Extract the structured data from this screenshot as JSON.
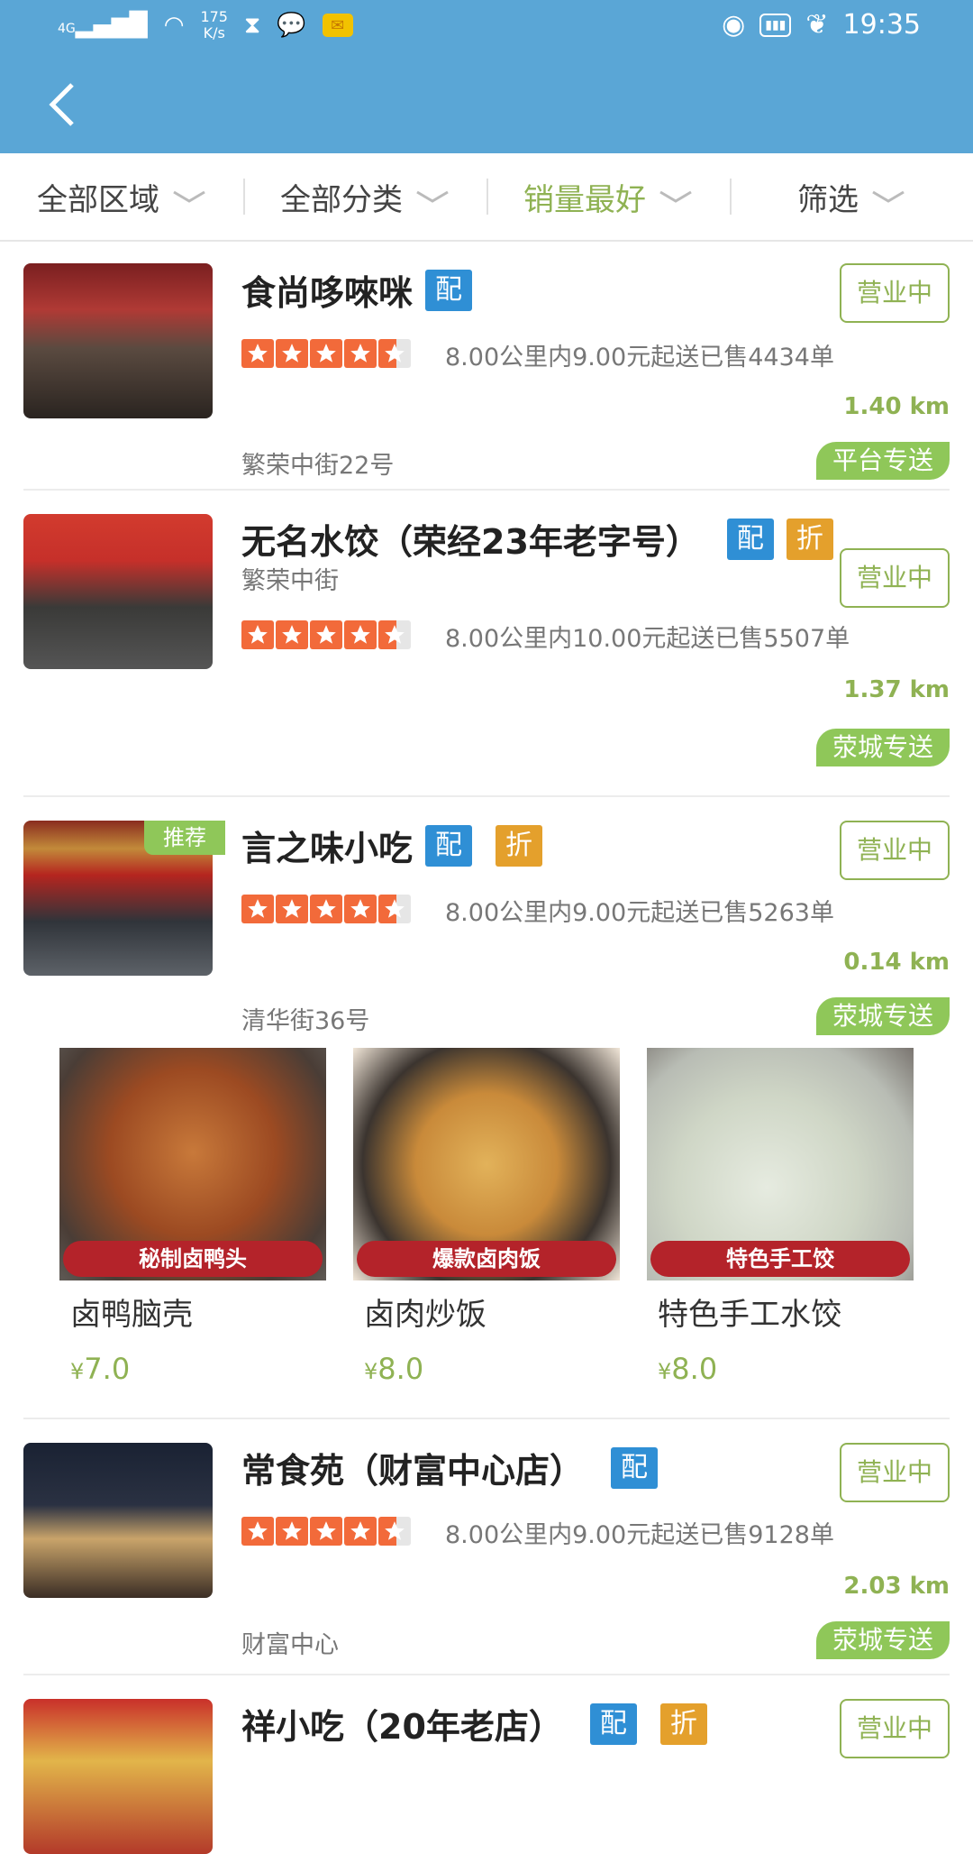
{
  "status": {
    "network": "4G",
    "speed_value": "175",
    "speed_unit": "K/s",
    "time": "19:35"
  },
  "filters": [
    {
      "label": "全部区域",
      "active": false
    },
    {
      "label": "全部分类",
      "active": false
    },
    {
      "label": "销量最好",
      "active": true
    },
    {
      "label": "筛选",
      "active": false
    }
  ],
  "shops": [
    {
      "name": "食尚哆唻咪",
      "tags": [
        "配"
      ],
      "status": "营业中",
      "rating": 4.5,
      "info": "8.00公里内9.00元起送已售4434单",
      "distance": "1.40 km",
      "address": "繁荣中街22号",
      "delivery": "平台专送",
      "recommended": false
    },
    {
      "name": "无名水饺（荣经23年老字号）",
      "tags": [
        "配",
        "折"
      ],
      "status": "营业中",
      "rating": 4.5,
      "info": "8.00公里内10.00元起送已售5507单",
      "distance": "1.37 km",
      "address": "繁荣中街",
      "delivery": "荥城专送",
      "recommended": false
    },
    {
      "name": "言之味小吃",
      "tags": [
        "配",
        "折"
      ],
      "status": "营业中",
      "rating": 4.5,
      "info": "8.00公里内9.00元起送已售5263单",
      "distance": "0.14 km",
      "address": "清华街36号",
      "delivery": "荥城专送",
      "recommended": true,
      "recommend_label": "推荐"
    },
    {
      "name": "常食苑（财富中心店）",
      "tags": [
        "配"
      ],
      "status": "营业中",
      "rating": 4.5,
      "info": "8.00公里内9.00元起送已售9128单",
      "distance": "2.03 km",
      "address": "财富中心",
      "delivery": "荥城专送",
      "recommended": false
    },
    {
      "name": "祥小吃（20年老店）",
      "tags": [
        "配",
        "折"
      ],
      "status": "营业中"
    }
  ],
  "dishes": [
    {
      "banner": "秘制卤鸭头",
      "name": "卤鸭脑壳",
      "currency": "¥",
      "price": "7.0"
    },
    {
      "banner": "爆款卤肉饭",
      "name": "卤肉炒饭",
      "currency": "¥",
      "price": "8.0"
    },
    {
      "banner": "特色手工饺",
      "name": "特色手工水饺",
      "currency": "¥",
      "price": "8.0"
    }
  ],
  "colors": {
    "header": "#5aa6d6",
    "accent_green": "#8fb253",
    "tag_blue": "#2f8fd5",
    "tag_orange": "#e4a02c",
    "star": "#f26a3a"
  }
}
